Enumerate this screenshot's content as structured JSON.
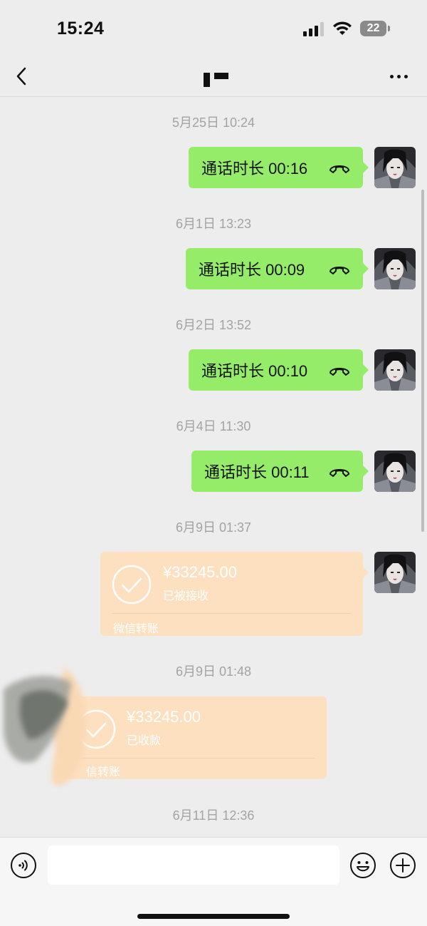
{
  "status_bar": {
    "time": "15:24",
    "battery": "22"
  },
  "header": {
    "title": ""
  },
  "messages": [
    {
      "timestamp": "5月25日 10:24",
      "type": "call",
      "side": "right",
      "text": "通话时长 00:16"
    },
    {
      "timestamp": "6月1日 13:23",
      "type": "call",
      "side": "right",
      "text": "通话时长 00:09"
    },
    {
      "timestamp": "6月2日 13:52",
      "type": "call",
      "side": "right",
      "text": "通话时长 00:10"
    },
    {
      "timestamp": "6月4日 11:30",
      "type": "call",
      "side": "right",
      "text": "通话时长 00:11"
    },
    {
      "timestamp": "6月9日 01:37",
      "type": "transfer",
      "side": "right",
      "amount": "¥33245.00",
      "status": "已被接收",
      "label": "微信转账"
    },
    {
      "timestamp": "6月9日 01:48",
      "type": "transfer",
      "side": "left",
      "amount": "¥33245.00",
      "status": "已收款",
      "label": "信转账"
    },
    {
      "timestamp": "6月11日 12:36"
    }
  ],
  "input": {
    "placeholder": ""
  },
  "colors": {
    "bubble_green": "#95ec69",
    "transfer_orange": "#fde0c0",
    "background": "#ededed"
  }
}
